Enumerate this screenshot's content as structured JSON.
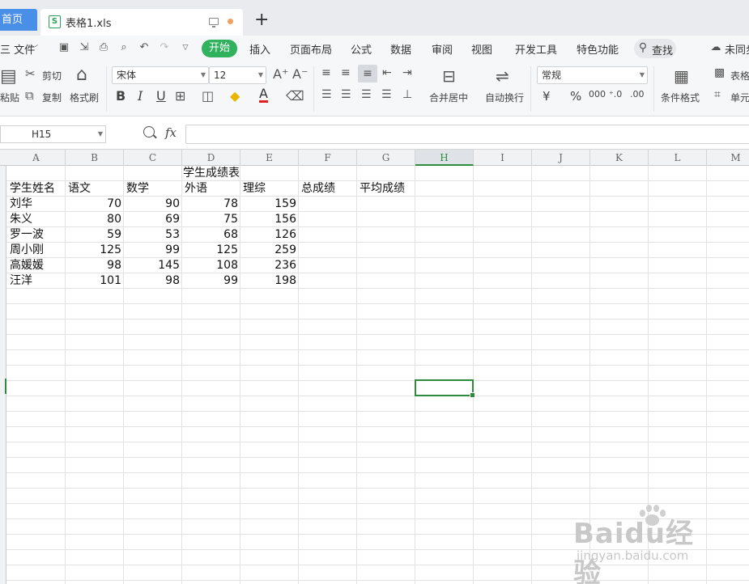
{
  "tabs": {
    "home": "首页",
    "file": "表格1.xls",
    "new": "+"
  },
  "menu": {
    "file": "三 文件",
    "start": "开始",
    "items": [
      "插入",
      "页面布局",
      "公式",
      "数据",
      "审阅",
      "视图",
      "开发工具",
      "特色功能"
    ],
    "search": "查找",
    "sync": "未同步"
  },
  "ribbon": {
    "paste": "粘贴",
    "cut": "剪切",
    "copy": "复制",
    "format_painter": "格式刷",
    "font_name": "宋体",
    "font_size": "12",
    "bold": "B",
    "italic": "I",
    "underline": "U",
    "font_color_glyph": "A",
    "merge_center": "合并居中",
    "wrap_text": "自动换行",
    "number_format": "常规",
    "currency": "¥",
    "percent": "%",
    "thousands": "000",
    "increase_decimal": "⁺.0",
    "decrease_decimal": ".00",
    "conditional_format": "条件格式",
    "table_style": "表格",
    "cell_style": "单元"
  },
  "formula_bar": {
    "cell_ref": "H15",
    "fx": "fx",
    "content": ""
  },
  "sheet": {
    "columns": [
      "A",
      "B",
      "C",
      "D",
      "E",
      "F",
      "G",
      "H",
      "I",
      "J",
      "K",
      "L",
      "M"
    ],
    "active_column": "H",
    "title": "学生成绩表",
    "headers": [
      "学生姓名",
      "语文",
      "数学",
      "外语",
      "理综",
      "总成绩",
      "平均成绩"
    ],
    "rows": [
      {
        "name": "刘华",
        "scores": [
          70,
          90,
          78,
          159
        ]
      },
      {
        "name": "朱义",
        "scores": [
          80,
          69,
          75,
          156
        ]
      },
      {
        "name": "罗一波",
        "scores": [
          59,
          53,
          68,
          126
        ]
      },
      {
        "name": "周小刚",
        "scores": [
          125,
          99,
          125,
          259
        ]
      },
      {
        "name": "高媛媛",
        "scores": [
          98,
          145,
          108,
          236
        ]
      },
      {
        "name": "汪洋",
        "scores": [
          101,
          98,
          99,
          198
        ]
      }
    ]
  },
  "watermark": {
    "main": "Baidu经验",
    "sub": "jingyan.baidu.com"
  },
  "colors": {
    "accent_green": "#2fb15d",
    "selection_green": "#2e8b3e",
    "home_tab_blue": "#4a8fe7"
  }
}
